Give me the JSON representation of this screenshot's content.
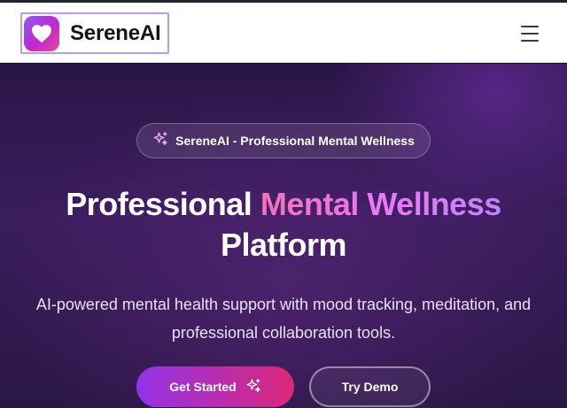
{
  "header": {
    "brand_name": "SereneAI",
    "logo_icon": "heart-icon",
    "menu_icon": "hamburger-menu-icon"
  },
  "hero": {
    "badge_icon": "sparkles-icon",
    "badge_text": "SereneAI - Professional Mental Wellness",
    "headline_part1": "Professional",
    "headline_accent": "Mental Wellness",
    "headline_part2": "Platform",
    "subtitle": "AI-powered mental health support with mood tracking, meditation, and professional collaboration tools.",
    "primary_button": "Get Started",
    "primary_button_icon": "sparkles-icon",
    "secondary_button": "Try Demo"
  },
  "colors": {
    "brand_gradient_start": "#8b5cf6",
    "brand_gradient_end": "#ec4899",
    "hero_background": "#3a1d5c",
    "accent_text_start": "#f472b6",
    "accent_text_end": "#c084fc",
    "primary_button_start": "#9333ea",
    "primary_button_end": "#db2777"
  }
}
